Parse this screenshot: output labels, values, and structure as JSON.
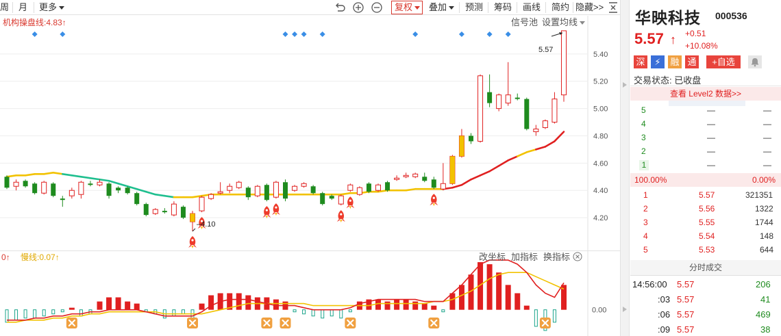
{
  "toolbar": {
    "period_week": "周",
    "period_month": "月",
    "more": "更多",
    "fuquan": "复权",
    "overlay": "叠加",
    "forecast": "预测",
    "chips": "筹码",
    "draw": "画线",
    "simple": "简约",
    "hide": "隐藏>>"
  },
  "main_chart": {
    "indicator_label": "机构操盘线:4.83",
    "signal_pool": "信号池",
    "set_ma": "设置均线",
    "high_label": "5.57",
    "low_label": "4.10"
  },
  "sub_chart": {
    "slow_line_label": "慢线:0.07",
    "fast_line_label": "0",
    "change_axis": "改坐标",
    "add_indicator": "加指标",
    "switch_indicator": "换指标"
  },
  "chart_data": {
    "type": "candlestick",
    "y_axis_ticks": [
      "5.40",
      "5.20",
      "5.00",
      "4.80",
      "4.60",
      "4.40",
      "4.20"
    ],
    "ylim": [
      4.05,
      5.63
    ],
    "candles": [
      {
        "o": 4.5,
        "h": 4.51,
        "l": 4.41,
        "c": 4.42
      },
      {
        "o": 4.43,
        "h": 4.48,
        "l": 4.4,
        "c": 4.46
      },
      {
        "o": 4.47,
        "h": 4.48,
        "l": 4.42,
        "c": 4.43
      },
      {
        "o": 4.45,
        "h": 4.46,
        "l": 4.37,
        "c": 4.38
      },
      {
        "o": 4.38,
        "h": 4.47,
        "l": 4.37,
        "c": 4.46
      },
      {
        "o": 4.45,
        "h": 4.46,
        "l": 4.35,
        "c": 4.36
      },
      {
        "o": 4.34,
        "h": 4.36,
        "l": 4.28,
        "c": 4.33
      },
      {
        "o": 4.36,
        "h": 4.42,
        "l": 4.34,
        "c": 4.4
      },
      {
        "o": 4.37,
        "h": 4.47,
        "l": 4.34,
        "c": 4.46
      },
      {
        "o": 4.45,
        "h": 4.47,
        "l": 4.43,
        "c": 4.44
      },
      {
        "o": 4.44,
        "h": 4.48,
        "l": 4.43,
        "c": 4.46
      },
      {
        "o": 4.45,
        "h": 4.46,
        "l": 4.34,
        "c": 4.36
      },
      {
        "o": 4.42,
        "h": 4.43,
        "l": 4.38,
        "c": 4.4
      },
      {
        "o": 4.42,
        "h": 4.43,
        "l": 4.37,
        "c": 4.38
      },
      {
        "o": 4.38,
        "h": 4.39,
        "l": 4.29,
        "c": 4.3
      },
      {
        "o": 4.3,
        "h": 4.31,
        "l": 4.21,
        "c": 4.22
      },
      {
        "o": 4.23,
        "h": 4.27,
        "l": 4.22,
        "c": 4.26
      },
      {
        "o": 4.25,
        "h": 4.27,
        "l": 4.23,
        "c": 4.24
      },
      {
        "o": 4.22,
        "h": 4.32,
        "l": 4.21,
        "c": 4.3
      },
      {
        "o": 4.28,
        "h": 4.29,
        "l": 4.19,
        "c": 4.2
      },
      {
        "o": 4.17,
        "h": 4.25,
        "l": 4.1,
        "c": 4.23
      },
      {
        "o": 4.25,
        "h": 4.36,
        "l": 4.24,
        "c": 4.35
      },
      {
        "o": 4.34,
        "h": 4.38,
        "l": 4.33,
        "c": 4.37
      },
      {
        "o": 4.38,
        "h": 4.46,
        "l": 4.37,
        "c": 4.39
      },
      {
        "o": 4.4,
        "h": 4.45,
        "l": 4.38,
        "c": 4.43
      },
      {
        "o": 4.42,
        "h": 4.47,
        "l": 4.41,
        "c": 4.46
      },
      {
        "o": 4.42,
        "h": 4.43,
        "l": 4.33,
        "c": 4.35
      },
      {
        "o": 4.36,
        "h": 4.44,
        "l": 4.35,
        "c": 4.43
      },
      {
        "o": 4.44,
        "h": 4.45,
        "l": 4.32,
        "c": 4.33
      },
      {
        "o": 4.35,
        "h": 4.47,
        "l": 4.34,
        "c": 4.46
      },
      {
        "o": 4.46,
        "h": 4.48,
        "l": 4.32,
        "c": 4.34
      },
      {
        "o": 4.4,
        "h": 4.44,
        "l": 4.39,
        "c": 4.43
      },
      {
        "o": 4.43,
        "h": 4.46,
        "l": 4.42,
        "c": 4.45
      },
      {
        "o": 4.43,
        "h": 4.44,
        "l": 4.37,
        "c": 4.38
      },
      {
        "o": 4.38,
        "h": 4.39,
        "l": 4.29,
        "c": 4.3
      },
      {
        "o": 4.36,
        "h": 4.37,
        "l": 4.33,
        "c": 4.34
      },
      {
        "o": 4.3,
        "h": 4.37,
        "l": 4.29,
        "c": 4.36
      },
      {
        "o": 4.4,
        "h": 4.45,
        "l": 4.39,
        "c": 4.44
      },
      {
        "o": 4.37,
        "h": 4.43,
        "l": 4.36,
        "c": 4.42
      },
      {
        "o": 4.45,
        "h": 4.46,
        "l": 4.38,
        "c": 4.39
      },
      {
        "o": 4.4,
        "h": 4.45,
        "l": 4.39,
        "c": 4.44
      },
      {
        "o": 4.46,
        "h": 4.47,
        "l": 4.39,
        "c": 4.4
      },
      {
        "o": 4.48,
        "h": 4.51,
        "l": 4.47,
        "c": 4.49
      },
      {
        "o": 4.5,
        "h": 4.53,
        "l": 4.49,
        "c": 4.51
      },
      {
        "o": 4.5,
        "h": 4.53,
        "l": 4.49,
        "c": 4.52
      },
      {
        "o": 4.5,
        "h": 4.53,
        "l": 4.46,
        "c": 4.47
      },
      {
        "o": 4.48,
        "h": 4.5,
        "l": 4.41,
        "c": 4.42
      },
      {
        "o": 4.41,
        "h": 4.6,
        "l": 4.4,
        "c": 4.45
      },
      {
        "o": 4.45,
        "h": 4.66,
        "l": 4.44,
        "c": 4.65
      },
      {
        "o": 4.65,
        "h": 4.85,
        "l": 4.64,
        "c": 4.8
      },
      {
        "o": 4.8,
        "h": 4.82,
        "l": 4.74,
        "c": 4.76
      },
      {
        "o": 4.76,
        "h": 5.25,
        "l": 4.75,
        "c": 5.24
      },
      {
        "o": 5.12,
        "h": 5.25,
        "l": 5.01,
        "c": 5.04
      },
      {
        "o": 5.0,
        "h": 5.11,
        "l": 4.98,
        "c": 5.1
      },
      {
        "o": 5.04,
        "h": 5.34,
        "l": 5.02,
        "c": 5.1
      },
      {
        "o": 5.08,
        "h": 5.11,
        "l": 5.06,
        "c": 5.07
      },
      {
        "o": 5.07,
        "h": 5.08,
        "l": 4.84,
        "c": 4.85
      },
      {
        "o": 4.83,
        "h": 4.88,
        "l": 4.8,
        "c": 4.85
      },
      {
        "o": 4.86,
        "h": 4.92,
        "l": 4.85,
        "c": 4.91
      },
      {
        "o": 4.9,
        "h": 5.12,
        "l": 4.89,
        "c": 5.07
      },
      {
        "o": 5.1,
        "h": 5.57,
        "l": 5.05,
        "c": 5.57
      }
    ],
    "institution_line": [
      4.5,
      4.51,
      4.51,
      4.52,
      4.52,
      4.53,
      4.52,
      4.51,
      4.5,
      4.49,
      4.48,
      4.47,
      4.45,
      4.43,
      4.41,
      4.39,
      4.37,
      4.36,
      4.35,
      4.35,
      4.35,
      4.36,
      4.37,
      4.37,
      4.37,
      4.37,
      4.37,
      4.37,
      4.37,
      4.37,
      4.37,
      4.37,
      4.37,
      4.37,
      4.37,
      4.37,
      4.37,
      4.38,
      4.38,
      4.39,
      4.39,
      4.4,
      4.4,
      4.4,
      4.41,
      4.41,
      4.41,
      4.41,
      4.42,
      4.44,
      4.48,
      4.51,
      4.54,
      4.58,
      4.62,
      4.65,
      4.68,
      4.7,
      4.72,
      4.76,
      4.83
    ],
    "macd_hist": [
      -0.06,
      -0.05,
      -0.04,
      -0.04,
      -0.03,
      -0.02,
      -0.01,
      0.01,
      -0.03,
      -0.02,
      0.04,
      0.06,
      0.06,
      0.04,
      0.03,
      -0.01,
      -0.02,
      -0.04,
      -0.03,
      -0.02,
      -0.05,
      0.03,
      0.07,
      0.08,
      0.08,
      0.08,
      0.07,
      0.06,
      0.06,
      0.05,
      0.04,
      -0.01,
      -0.02,
      -0.03,
      -0.04,
      -0.03,
      -0.04,
      -0.01,
      0.04,
      0.05,
      0.05,
      0.04,
      0.05,
      0.05,
      0.04,
      0.03,
      0.02,
      -0.01,
      0.08,
      0.12,
      0.17,
      0.23,
      0.22,
      0.18,
      0.12,
      0.08,
      0.02,
      -0.08,
      -0.1,
      -0.06,
      0.12
    ],
    "macd_fast": [
      -0.05,
      -0.05,
      -0.05,
      -0.04,
      -0.04,
      -0.03,
      -0.03,
      -0.02,
      -0.02,
      -0.01,
      -0.01,
      0.0,
      0.0,
      0.0,
      0.0,
      -0.01,
      -0.02,
      -0.03,
      -0.03,
      -0.03,
      -0.03,
      -0.01,
      0.02,
      0.04,
      0.05,
      0.05,
      0.05,
      0.04,
      0.03,
      0.02,
      0.02,
      0.02,
      0.01,
      0.0,
      0.0,
      0.0,
      0.0,
      0.01,
      0.03,
      0.04,
      0.05,
      0.05,
      0.05,
      0.05,
      0.05,
      0.04,
      0.04,
      0.04,
      0.08,
      0.12,
      0.17,
      0.22,
      0.24,
      0.24,
      0.24,
      0.22,
      0.18,
      0.12,
      0.08,
      0.06,
      0.13
    ],
    "macd_slow": [
      -0.06,
      -0.06,
      -0.05,
      -0.05,
      -0.05,
      -0.04,
      -0.04,
      -0.03,
      -0.03,
      -0.02,
      -0.02,
      -0.01,
      -0.01,
      -0.01,
      -0.01,
      -0.01,
      -0.01,
      -0.02,
      -0.02,
      -0.02,
      -0.02,
      -0.02,
      -0.01,
      0.0,
      0.01,
      0.02,
      0.03,
      0.03,
      0.03,
      0.03,
      0.03,
      0.03,
      0.03,
      0.02,
      0.02,
      0.02,
      0.02,
      0.02,
      0.02,
      0.02,
      0.03,
      0.03,
      0.03,
      0.03,
      0.03,
      0.03,
      0.04,
      0.04,
      0.05,
      0.07,
      0.09,
      0.12,
      0.15,
      0.17,
      0.18,
      0.18,
      0.18,
      0.16,
      0.14,
      0.12,
      0.1
    ],
    "sub_ylim": [
      -0.12,
      0.26
    ],
    "sub_y_tick": "0.00",
    "diamond_markers": [
      3,
      6,
      30,
      31,
      32,
      34,
      44,
      49,
      52,
      54
    ],
    "rocket_markers": [
      20,
      21,
      28,
      29,
      36,
      37,
      46
    ],
    "x_markers": [
      7,
      20,
      28,
      30,
      37,
      46,
      58
    ]
  },
  "quote": {
    "name": "华映科技",
    "code": "000536",
    "price": "5.57",
    "arrow": "↑",
    "change": "+0.51",
    "change_pct": "+10.08%",
    "badges": [
      "深",
      "⚡",
      "融",
      "通"
    ],
    "add_watch": "+自选",
    "status": "交易状态: 已收盘",
    "level2": "查看 Level2 数据>>"
  },
  "orderbook": {
    "asks": [
      {
        "level": "5",
        "price": "—",
        "vol": "—"
      },
      {
        "level": "4",
        "price": "—",
        "vol": "—"
      },
      {
        "level": "3",
        "price": "—",
        "vol": "—"
      },
      {
        "level": "2",
        "price": "—",
        "vol": "—"
      },
      {
        "level": "1",
        "price": "—",
        "vol": "—"
      }
    ],
    "ratio_left": "100.00%",
    "ratio_right": "0.00%",
    "bids": [
      {
        "level": "1",
        "price": "5.57",
        "vol": "321351"
      },
      {
        "level": "2",
        "price": "5.56",
        "vol": "1322"
      },
      {
        "level": "3",
        "price": "5.55",
        "vol": "1744"
      },
      {
        "level": "4",
        "price": "5.54",
        "vol": "148"
      },
      {
        "level": "5",
        "price": "5.53",
        "vol": "644"
      }
    ]
  },
  "ticks": {
    "title": "分时成交",
    "rows": [
      {
        "time": "14:56:00",
        "price": "5.57",
        "vol": "206"
      },
      {
        "time": ":03",
        "price": "5.57",
        "vol": "41"
      },
      {
        "time": ":06",
        "price": "5.57",
        "vol": "469"
      },
      {
        "time": ":09",
        "price": "5.57",
        "vol": "38"
      }
    ]
  },
  "colors": {
    "up": "#e02020",
    "down": "#1e8b1e",
    "ma_yellow": "#f2c200",
    "ma_teal": "#1fbf8f",
    "accent": "#d9382e",
    "diamond": "#3a8ee6",
    "x_badge": "#f0a040"
  }
}
